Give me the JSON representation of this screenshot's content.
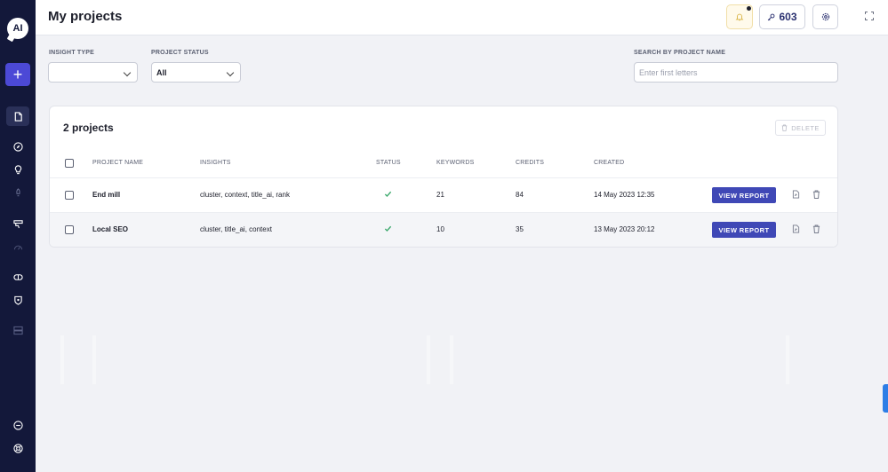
{
  "app": {
    "logo_text": "AI"
  },
  "sidebar": {
    "items": [
      {
        "name": "sidebar-item-projects",
        "icon": "document-icon",
        "active": true
      },
      {
        "name": "sidebar-item-explore",
        "icon": "compass-icon"
      },
      {
        "name": "sidebar-item-ideas",
        "icon": "lightbulb-icon"
      },
      {
        "name": "sidebar-item-launch",
        "icon": "rocket-icon"
      },
      {
        "name": "sidebar-item-keywords",
        "icon": "tag-icon"
      },
      {
        "name": "sidebar-item-speed",
        "icon": "gauge-icon"
      },
      {
        "name": "sidebar-item-compare",
        "icon": "link-icon"
      },
      {
        "name": "sidebar-item-security",
        "icon": "shield-icon"
      },
      {
        "name": "sidebar-item-server",
        "icon": "server-icon"
      },
      {
        "name": "sidebar-item-help",
        "icon": "help-icon"
      },
      {
        "name": "sidebar-item-support",
        "icon": "lifebuoy-icon"
      }
    ]
  },
  "header": {
    "title": "My projects",
    "credits": "603"
  },
  "filters": {
    "insight_type_label": "INSIGHT TYPE",
    "insight_type_value": "",
    "project_status_label": "PROJECT STATUS",
    "project_status_value": "All",
    "search_label": "SEARCH BY PROJECT NAME",
    "search_placeholder": "Enter first letters",
    "search_value": ""
  },
  "projects": {
    "count_label": "2 projects",
    "delete_label": "DELETE",
    "columns": {
      "name": "PROJECT NAME",
      "insights": "INSIGHTS",
      "status": "STATUS",
      "keywords": "KEYWORDS",
      "credits": "CREDITS",
      "created": "CREATED"
    },
    "rows": [
      {
        "name": "End mill",
        "insights": "cluster, context, title_ai, rank",
        "keywords": "21",
        "credits": "84",
        "created": "14 May 2023 12:35",
        "action": "VIEW REPORT"
      },
      {
        "name": "Local SEO",
        "insights": "cluster, title_ai, context",
        "keywords": "10",
        "credits": "35",
        "created": "13 May 2023 20:12",
        "action": "VIEW REPORT"
      }
    ]
  },
  "colors": {
    "sidebar_bg": "#13183a",
    "accent": "#4c49d6",
    "view_button": "#3f48b6",
    "status_ok": "#3aa86b"
  }
}
